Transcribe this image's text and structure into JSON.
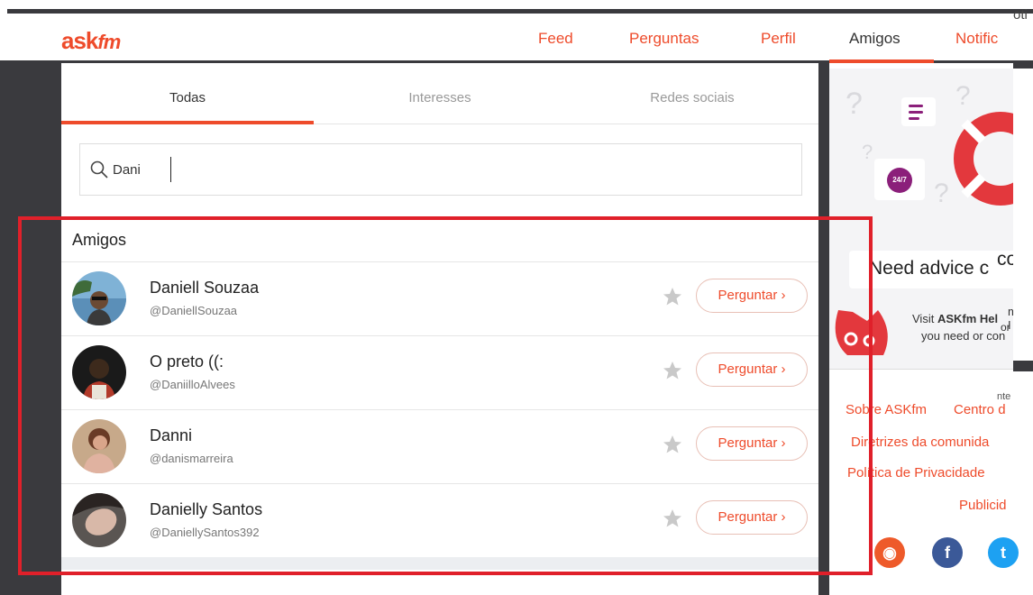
{
  "header": {
    "logo": "ask",
    "logo_suffix": "fm",
    "nav": [
      "Feed",
      "Perguntas",
      "Perfil",
      "Amigos",
      "Notific"
    ],
    "cutoff": "oti"
  },
  "tabs": [
    "Todas",
    "Interesses",
    "Redes sociais"
  ],
  "search": {
    "value": "Dani"
  },
  "section_title": "Amigos",
  "friends": [
    {
      "name": "Daniell Souzaa",
      "handle": "@DaniellSouzaa",
      "ask": "Perguntar ›"
    },
    {
      "name": "O preto ((:",
      "handle": "@DaniilloAlvees",
      "ask": "Perguntar ›"
    },
    {
      "name": "Danni",
      "handle": "@danismarreira",
      "ask": "Perguntar ›"
    },
    {
      "name": "Danielly Santos",
      "handle": "@DaniellySantos392",
      "ask": "Perguntar ›"
    }
  ],
  "promo": {
    "title": "Need advice c",
    "overlap": "co",
    "text1": "Visit ",
    "text1_bold": "ASKfm Hel",
    "text1_end": "m I",
    "text1_or": "or",
    "text2": "you need or con",
    "badge": "24/7"
  },
  "footer_links": [
    "Sobre ASKfm",
    "Centro d",
    "Diretrizes da comunida",
    "Política de Privacidade",
    "Publicid",
    "nte"
  ],
  "colors": {
    "accent": "#ee4b2b",
    "dark": "#3a3a3e",
    "highlight": "#e0202a"
  }
}
